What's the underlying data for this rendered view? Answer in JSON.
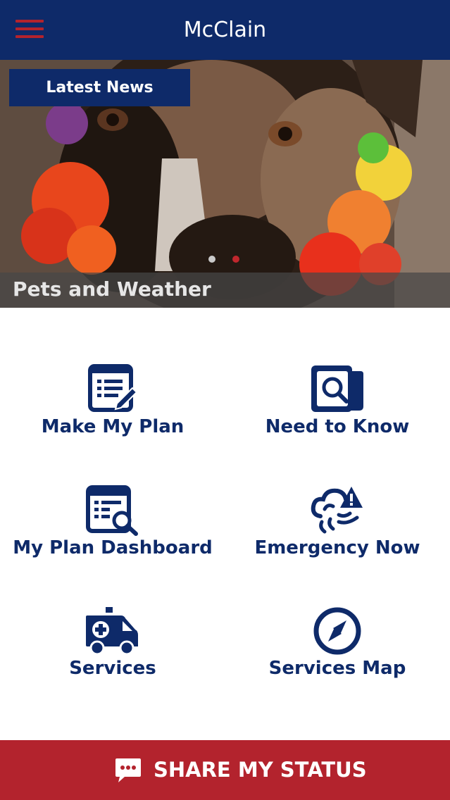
{
  "header": {
    "title": "McClain",
    "menu_icon": "hamburger-menu-icon"
  },
  "carousel": {
    "badge": "Latest News",
    "caption": "Pets and Weather",
    "page_count": 2,
    "active_page": 2
  },
  "tiles": [
    {
      "label": "Make My Plan",
      "icon": "plan-edit-icon"
    },
    {
      "label": "Need to Know",
      "icon": "search-documents-icon"
    },
    {
      "label": "My Plan Dashboard",
      "icon": "dashboard-search-icon"
    },
    {
      "label": "Emergency Now",
      "icon": "storm-alert-icon"
    },
    {
      "label": "Services",
      "icon": "ambulance-icon"
    },
    {
      "label": "Services Map",
      "icon": "compass-icon"
    }
  ],
  "footer": {
    "share_label": "SHARE MY STATUS",
    "share_icon": "chat-bubble-icon"
  },
  "colors": {
    "navy": "#0e2a69",
    "red": "#b3232d"
  }
}
